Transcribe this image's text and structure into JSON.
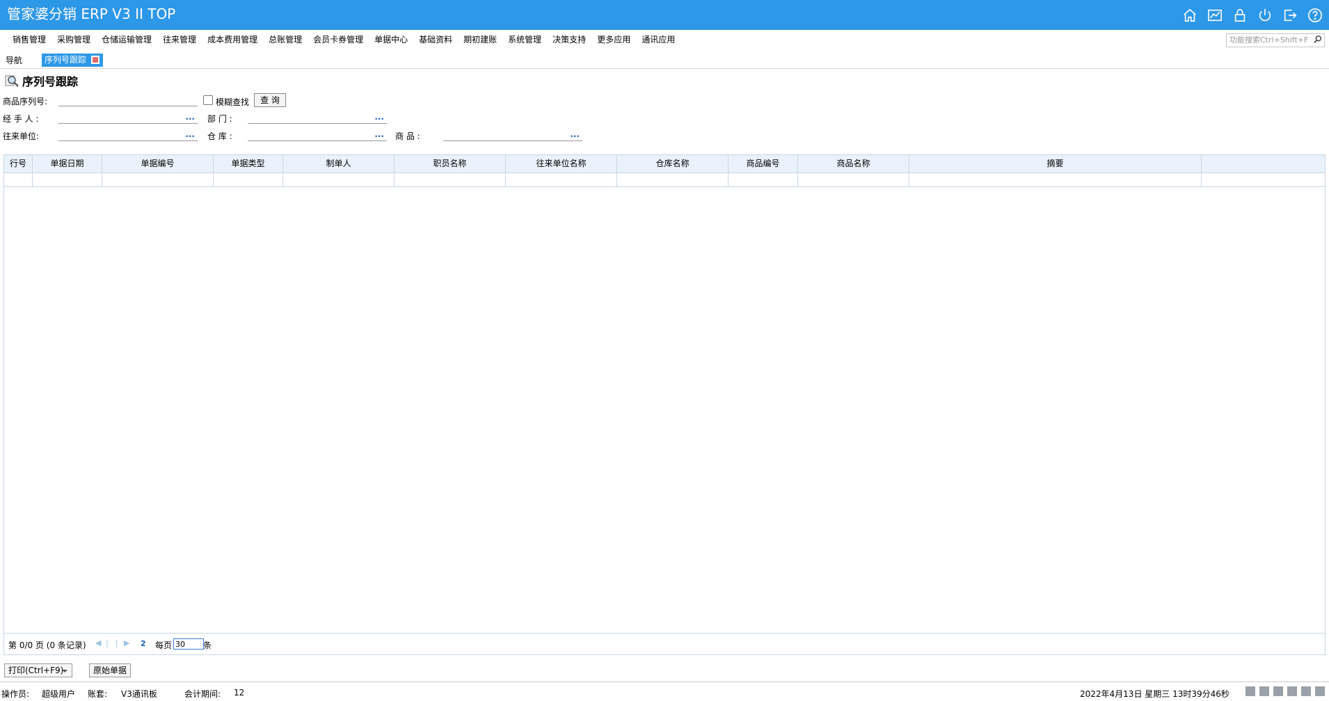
{
  "app": {
    "title": "管家婆分销 ERP V3 II TOP"
  },
  "title_icons": [
    "home-icon",
    "chart-icon",
    "lock-icon",
    "power-icon",
    "exit-icon",
    "help-icon"
  ],
  "menu": [
    "销售管理",
    "采购管理",
    "仓储运输管理",
    "往来管理",
    "成本费用管理",
    "总账管理",
    "会员卡券管理",
    "单据中心",
    "基础资料",
    "期初建账",
    "系统管理",
    "决策支持",
    "更多应用",
    "通讯应用"
  ],
  "search": {
    "placeholder": "功能搜索Ctrl+Shift+F"
  },
  "tabs": {
    "nav": "导航",
    "active": "序列号跟踪"
  },
  "page_title": "序列号跟踪",
  "form": {
    "serial_label": "商品序列号:",
    "fuzzy_label": "模糊查找",
    "query_button": "查 询",
    "handler_label": "经 手 人 :",
    "dept_label": "部 门 :",
    "partner_label": "往来单位:",
    "warehouse_label": "仓 库 :",
    "product_label": "商 品 :",
    "dots": "···"
  },
  "grid": {
    "columns": [
      "行号",
      "单据日期",
      "单据编号",
      "单据类型",
      "制单人",
      "职员名称",
      "往来单位名称",
      "仓库名称",
      "商品编号",
      "商品名称",
      "摘要",
      ""
    ]
  },
  "pager": {
    "info": "第 0/0 页 (0 条记录)",
    "refresh": "2",
    "per_page_label": "每页",
    "per_page_value": "30",
    "unit": "条"
  },
  "buttons": {
    "print": "打印(Ctrl+F9)",
    "original": "原始单据"
  },
  "status": {
    "operator_label": "操作员:",
    "operator": "超级用户",
    "account_label": "账套:",
    "account": "V3通讯板",
    "period_label": "会计期间:",
    "period": "12",
    "datetime": "2022年4月13日  星期三  13时39分46秒"
  },
  "colors": {
    "titlebar": "#2d97e8",
    "grid_header": "#e9f2fb"
  }
}
